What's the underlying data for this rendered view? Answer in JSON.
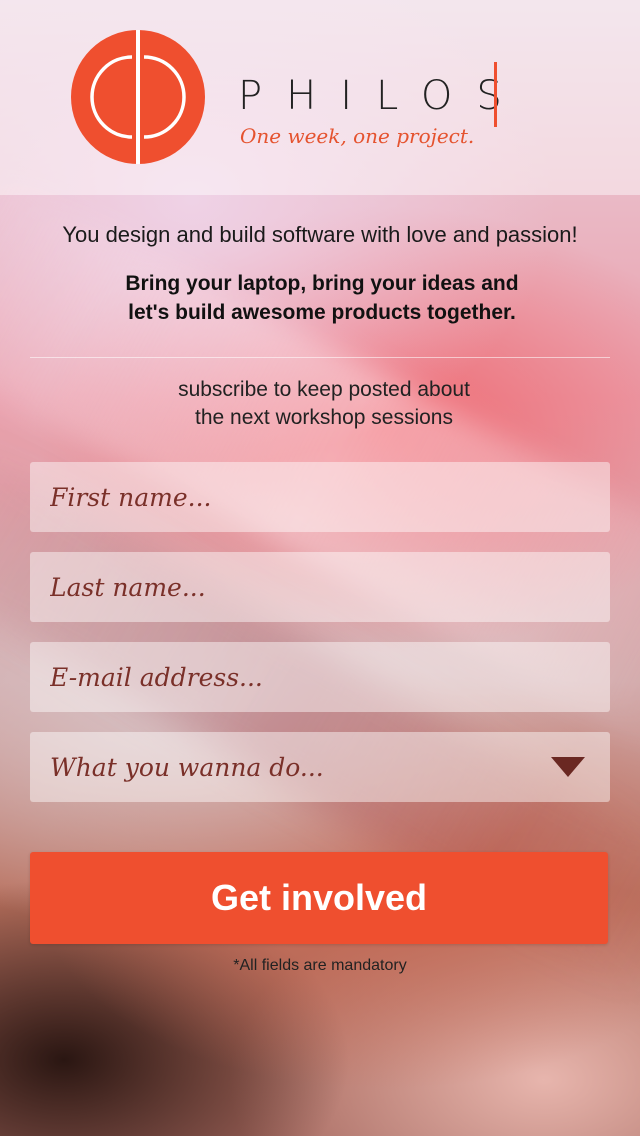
{
  "brand": {
    "name": "PHILOS",
    "tagline": "One week, one project."
  },
  "intro": "You design and build software with love and passion!",
  "highlight": {
    "line1": "Bring your laptop, bring your ideas and",
    "line2": "let's build awesome products together."
  },
  "subscribe": {
    "line1": "subscribe to keep posted about",
    "line2": "the next workshop sessions"
  },
  "form": {
    "first_name_placeholder": "First name...",
    "last_name_placeholder": "Last name...",
    "email_placeholder": "E-mail address...",
    "select_value": "What you wanna do...",
    "submit_label": "Get involved",
    "note": "*All fields are mandatory"
  },
  "colors": {
    "accent": "#ef4f2f",
    "placeholder": "#7a3029"
  }
}
